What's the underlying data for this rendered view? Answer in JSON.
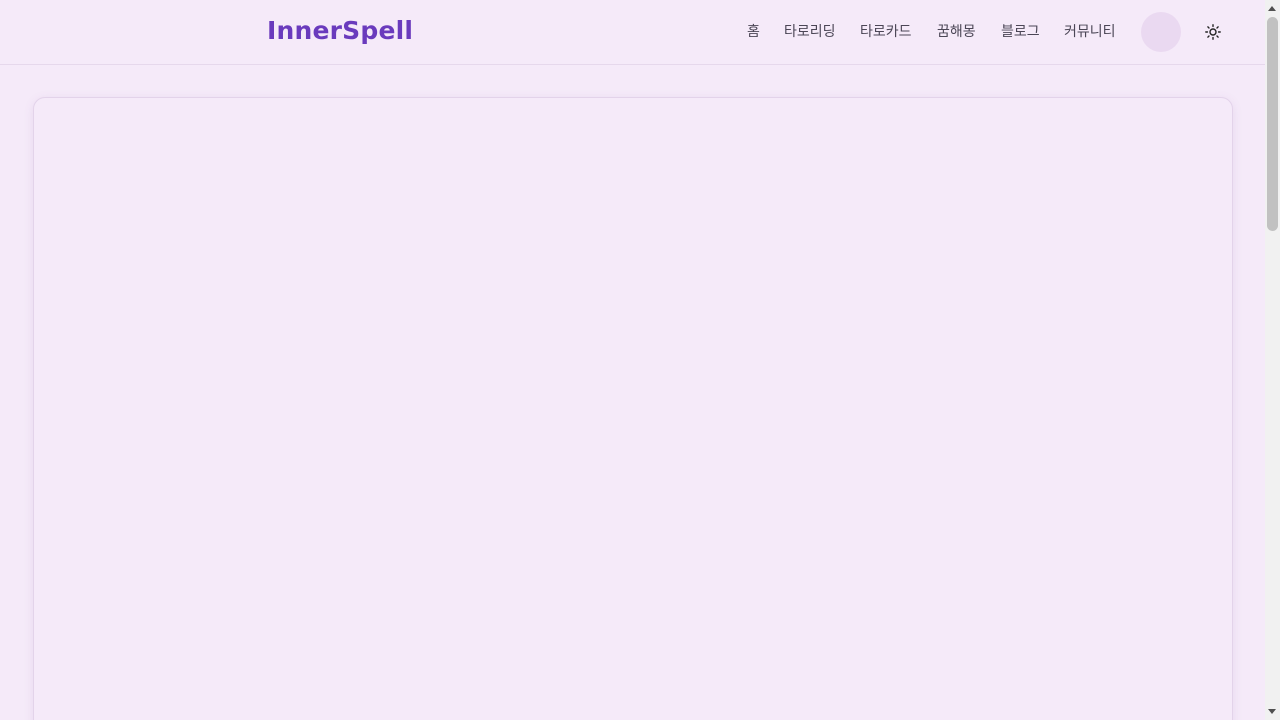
{
  "header": {
    "logo": "InnerSpell",
    "nav": [
      {
        "label": "홈"
      },
      {
        "label": "타로리딩"
      },
      {
        "label": "타로카드"
      },
      {
        "label": "꿈해몽"
      },
      {
        "label": "블로그"
      },
      {
        "label": "커뮤니티"
      }
    ],
    "theme_toggle_icon": "sun-icon"
  },
  "colors": {
    "brand": "#6a3bbd",
    "background": "#f5eaf9",
    "nav_text": "#4b4656",
    "avatar_placeholder": "#ead9f1"
  }
}
